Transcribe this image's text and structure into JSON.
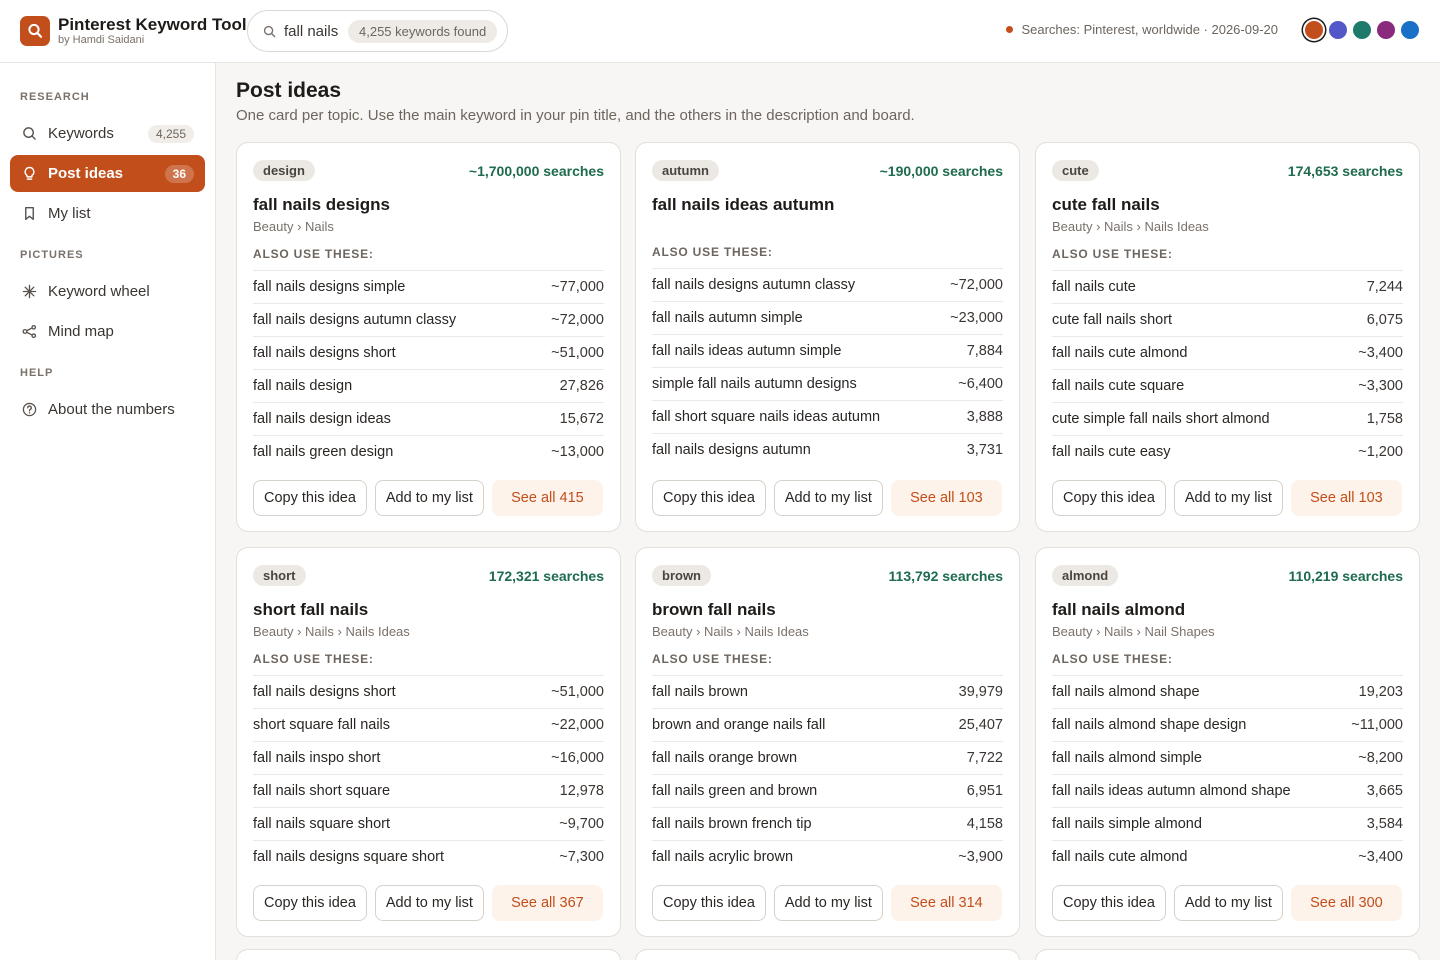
{
  "header": {
    "app_title": "Pinterest Keyword Tool",
    "app_subtitle": "by Hamdi Saidani",
    "search_value": "fall nails",
    "keywords_found": "4,255 keywords found",
    "status": "Searches: Pinterest, worldwide · 2026-09-20",
    "swatches": [
      "#c24e1c",
      "#5457c8",
      "#1e7a6a",
      "#8a2a7d",
      "#1a6fc6"
    ]
  },
  "sidebar": {
    "research_label": "RESEARCH",
    "pictures_label": "PICTURES",
    "help_label": "HELP",
    "keywords": {
      "label": "Keywords",
      "badge": "4,255"
    },
    "post_ideas": {
      "label": "Post ideas",
      "badge": "36"
    },
    "my_list": {
      "label": "My list"
    },
    "keyword_wheel": {
      "label": "Keyword wheel"
    },
    "mind_map": {
      "label": "Mind map"
    },
    "about": {
      "label": "About the numbers"
    }
  },
  "main": {
    "title": "Post ideas",
    "subtitle": "One card per topic. Use the main keyword in your pin title, and the others in the description and board.",
    "also_label": "ALSO USE THESE:",
    "copy_label": "Copy this idea",
    "add_label": "Add to my list",
    "cards": [
      {
        "tag": "design",
        "searches": "~1,700,000 searches",
        "title": "fall nails designs",
        "crumb": "Beauty › Nails",
        "rows": [
          {
            "k": "fall nails designs simple",
            "v": "~77,000"
          },
          {
            "k": "fall nails designs autumn classy",
            "v": "~72,000"
          },
          {
            "k": "fall nails designs short",
            "v": "~51,000"
          },
          {
            "k": "fall nails design",
            "v": "27,826"
          },
          {
            "k": "fall nails design ideas",
            "v": "15,672"
          },
          {
            "k": "fall nails green design",
            "v": "~13,000"
          }
        ],
        "see_all": "See all 415"
      },
      {
        "tag": "autumn",
        "searches": "~190,000 searches",
        "title": "fall nails ideas autumn",
        "crumb": "",
        "rows": [
          {
            "k": "fall nails designs autumn classy",
            "v": "~72,000"
          },
          {
            "k": "fall nails autumn simple",
            "v": "~23,000"
          },
          {
            "k": "fall nails ideas autumn simple",
            "v": "7,884"
          },
          {
            "k": "simple fall nails autumn designs",
            "v": "~6,400"
          },
          {
            "k": "fall short square nails ideas autumn",
            "v": "3,888"
          },
          {
            "k": "fall nails designs autumn",
            "v": "3,731"
          }
        ],
        "see_all": "See all 103"
      },
      {
        "tag": "cute",
        "searches": "174,653 searches",
        "title": "cute fall nails",
        "crumb": "Beauty › Nails › Nails Ideas",
        "rows": [
          {
            "k": "fall nails cute",
            "v": "7,244"
          },
          {
            "k": "cute fall nails short",
            "v": "6,075"
          },
          {
            "k": "fall nails cute almond",
            "v": "~3,400"
          },
          {
            "k": "fall nails cute square",
            "v": "~3,300"
          },
          {
            "k": "cute simple fall nails short almond",
            "v": "1,758"
          },
          {
            "k": "fall nails cute easy",
            "v": "~1,200"
          }
        ],
        "see_all": "See all 103"
      },
      {
        "tag": "short",
        "searches": "172,321 searches",
        "title": "short fall nails",
        "crumb": "Beauty › Nails › Nails Ideas",
        "rows": [
          {
            "k": "fall nails designs short",
            "v": "~51,000"
          },
          {
            "k": "short square fall nails",
            "v": "~22,000"
          },
          {
            "k": "fall nails inspo short",
            "v": "~16,000"
          },
          {
            "k": "fall nails short square",
            "v": "12,978"
          },
          {
            "k": "fall nails square short",
            "v": "~9,700"
          },
          {
            "k": "fall nails designs square short",
            "v": "~7,300"
          }
        ],
        "see_all": "See all 367"
      },
      {
        "tag": "brown",
        "searches": "113,792 searches",
        "title": "brown fall nails",
        "crumb": "Beauty › Nails › Nails Ideas",
        "rows": [
          {
            "k": "fall nails brown",
            "v": "39,979"
          },
          {
            "k": "brown and orange nails fall",
            "v": "25,407"
          },
          {
            "k": "fall nails orange brown",
            "v": "7,722"
          },
          {
            "k": "fall nails green and brown",
            "v": "6,951"
          },
          {
            "k": "fall nails brown french tip",
            "v": "4,158"
          },
          {
            "k": "fall nails acrylic brown",
            "v": "~3,900"
          }
        ],
        "see_all": "See all 314"
      },
      {
        "tag": "almond",
        "searches": "110,219 searches",
        "title": "fall nails almond",
        "crumb": "Beauty › Nails › Nail Shapes",
        "rows": [
          {
            "k": "fall nails almond shape",
            "v": "19,203"
          },
          {
            "k": "fall nails almond shape design",
            "v": "~11,000"
          },
          {
            "k": "fall nails almond simple",
            "v": "~8,200"
          },
          {
            "k": "fall nails ideas autumn almond shape",
            "v": "3,665"
          },
          {
            "k": "fall nails simple almond",
            "v": "3,584"
          },
          {
            "k": "fall nails cute almond",
            "v": "~3,400"
          }
        ],
        "see_all": "See all 300"
      }
    ]
  }
}
